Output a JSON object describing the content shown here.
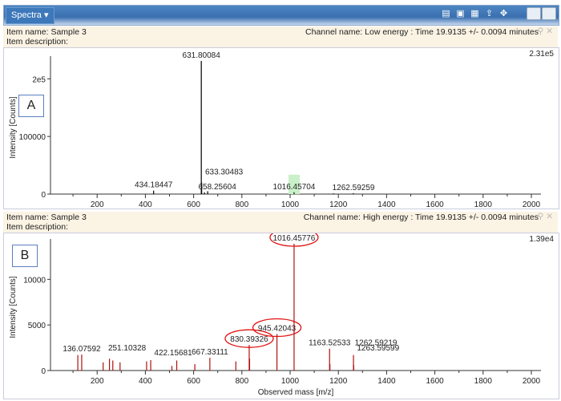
{
  "toolbar": {
    "menu_label": "Spectra ▾"
  },
  "panels": [
    {
      "label": "A",
      "item_name": "Item name: Sample 3",
      "item_description": "Item description:",
      "channel": "Channel name: Low energy : Time 19.9135 +/- 0.0094 minutes",
      "max_label": "2.31e5",
      "ylabel": "Intensity [Counts]",
      "xlabel": "",
      "color": "#000000",
      "y_ticks": [
        {
          "v": 0,
          "t": "0"
        },
        {
          "v": 100000,
          "t": "100000"
        },
        {
          "v": 200000,
          "t": "2e5"
        }
      ],
      "ymax": 231000,
      "peaks": [
        {
          "mz": 434.18447,
          "i": 6000,
          "label": "434.18447"
        },
        {
          "mz": 631.80084,
          "i": 231000,
          "label": "631.80084"
        },
        {
          "mz": 633.30483,
          "i": 20000,
          "label": "633.30483"
        },
        {
          "mz": 658.25604,
          "i": 5000,
          "label": "658.25604"
        },
        {
          "mz": 1016.45704,
          "i": 3000,
          "label": "1016.45704",
          "highlight": true
        },
        {
          "mz": 1262.59259,
          "i": 1500,
          "label": "1262.59259"
        },
        {
          "mz": 645,
          "i": 3000
        },
        {
          "mz": 1180,
          "i": 1200
        }
      ]
    },
    {
      "label": "B",
      "item_name": "Item name: Sample 3",
      "item_description": "Item description:",
      "channel": "Channel name: High energy : Time 19.9135 +/- 0.0094 minutes",
      "max_label": "1.39e4",
      "ylabel": "Intensity [Counts]",
      "xlabel": "Observed mass [m/z]",
      "color": "#b01010",
      "y_ticks": [
        {
          "v": 0,
          "t": "0"
        },
        {
          "v": 5000,
          "t": "5000"
        },
        {
          "v": 10000,
          "t": "10000"
        }
      ],
      "ymax": 13900,
      "peaks": [
        {
          "mz": 120,
          "i": 1700
        },
        {
          "mz": 136.07592,
          "i": 1750,
          "label": "136.07592"
        },
        {
          "mz": 225,
          "i": 900
        },
        {
          "mz": 251.10328,
          "i": 1300,
          "label": "251.10328"
        },
        {
          "mz": 265,
          "i": 1100
        },
        {
          "mz": 295,
          "i": 900
        },
        {
          "mz": 405,
          "i": 1000
        },
        {
          "mz": 422.15681,
          "i": 1150,
          "label": "422.15681"
        },
        {
          "mz": 510,
          "i": 500
        },
        {
          "mz": 530,
          "i": 1100
        },
        {
          "mz": 605,
          "i": 700
        },
        {
          "mz": 667.33111,
          "i": 1400,
          "label": "667.33111"
        },
        {
          "mz": 775,
          "i": 1000
        },
        {
          "mz": 830.39326,
          "i": 2800,
          "label": "830.39326",
          "circled": true
        },
        {
          "mz": 832,
          "i": 1300
        },
        {
          "mz": 945.42043,
          "i": 4000,
          "label": "945.42043",
          "circled": true
        },
        {
          "mz": 1016.45776,
          "i": 13900,
          "label": "1016.45776",
          "circled": true
        },
        {
          "mz": 1163.52533,
          "i": 2400,
          "label": "1163.52533"
        },
        {
          "mz": 1165,
          "i": 700
        },
        {
          "mz": 1262.59219,
          "i": 1700,
          "label": "1262.59219"
        },
        {
          "mz": 1263.59599,
          "i": 600,
          "label": "1263.59599"
        }
      ]
    }
  ],
  "x_ticks": [
    200,
    400,
    600,
    800,
    1000,
    1200,
    1400,
    1600,
    1800,
    2000
  ]
}
